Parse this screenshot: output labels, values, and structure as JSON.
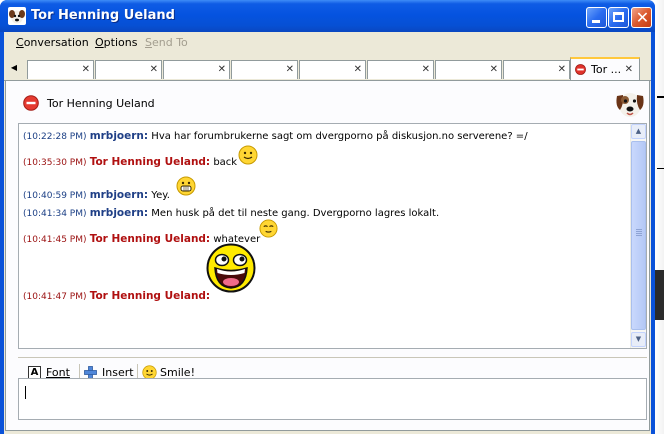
{
  "window": {
    "title": "Tor Henning Ueland"
  },
  "menu": {
    "conversation": "Conversation",
    "options": "Options",
    "send_to": "Send To"
  },
  "tabs": {
    "active_label": "Tor ..."
  },
  "contact": {
    "name": "Tor Henning Ueland",
    "status_icon": "stop-icon",
    "avatar_icon": "dog-avatar-icon"
  },
  "messages": [
    {
      "time": "(10:22:28 PM)",
      "nick": "mrbjoern:",
      "text": "Hva har forumbrukerne sagt om dvergporno på diskusjon.no serverene? =/"
    },
    {
      "time": "(10:35:30 PM)",
      "nick": "Tor Henning Ueland:",
      "text": "back",
      "smiley": "smile-icon"
    },
    {
      "time": "(10:40:59 PM)",
      "nick": "mrbjoern:",
      "text": "Yey.",
      "smiley": "grin-icon"
    },
    {
      "time": "(10:41:34 PM)",
      "nick": "mrbjoern:",
      "text": "Men husk på det til neste gang. Dvergporno lagres lokalt."
    },
    {
      "time": "(10:41:45 PM)",
      "nick": "Tor Henning Ueland:",
      "text": "whatever",
      "smiley": "meh-icon"
    },
    {
      "time": "(10:41:47 PM)",
      "nick": "Tor Henning Ueland:",
      "text": "",
      "smiley": "awesome-face-icon"
    }
  ],
  "toolbar": {
    "font": "Font",
    "insert": "Insert",
    "smile": "Smile!"
  },
  "colors": {
    "titlebar": "#0553e0",
    "self_nick": "#1f3f86",
    "buddy_nick": "#b01010",
    "window_bg": "#ece9d8"
  }
}
